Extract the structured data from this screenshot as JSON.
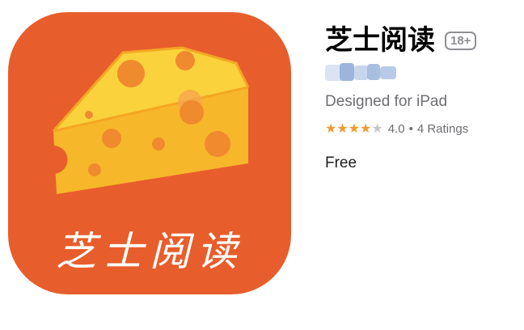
{
  "app": {
    "icon": {
      "caption": "芝士阅读",
      "background_color": "#e85d2c",
      "cheese_color": "#f7c02b",
      "hole_color": "#f08a2e"
    },
    "title": "芝士阅读",
    "age_rating": "18+",
    "developer_blurred": true,
    "designed_for": "Designed for iPad",
    "rating": {
      "stars_filled": 4,
      "stars_total": 5,
      "value": "4.0",
      "separator": "•",
      "count": "4 Ratings"
    },
    "price": "Free",
    "accent_star_color": "#f09a34"
  }
}
